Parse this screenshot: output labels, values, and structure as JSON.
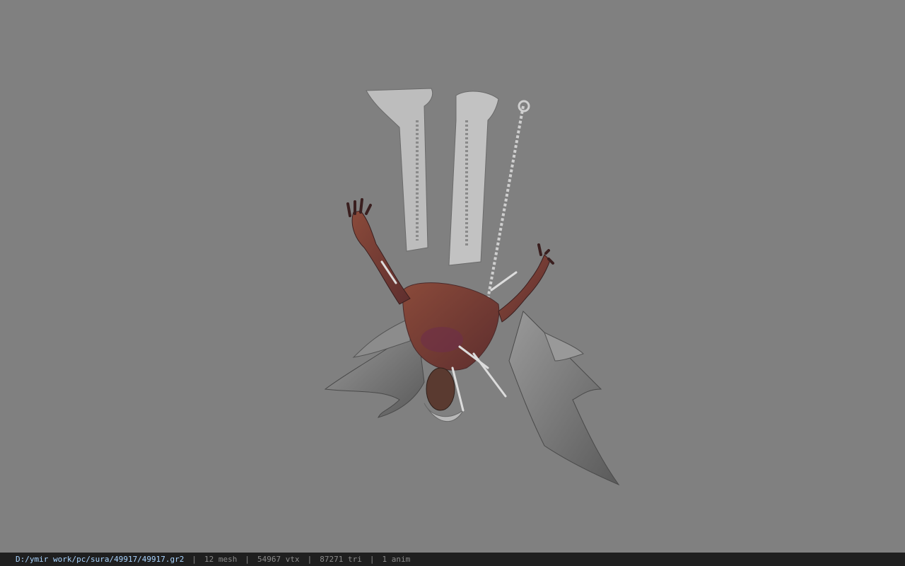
{
  "viewer": {
    "background_color": "#808080",
    "model_icon": "upside-down-winged-demon-model"
  },
  "status": {
    "file_path": "D:/ymir work/pc/sura/49917/49917.gr2",
    "mesh": "12 mesh",
    "vtx": "54967 vtx",
    "tri": "87271 tri",
    "anim": "1 anim",
    "separator": "|",
    "path_color": "#a9d4ff",
    "text_color": "#8a8a8a"
  }
}
